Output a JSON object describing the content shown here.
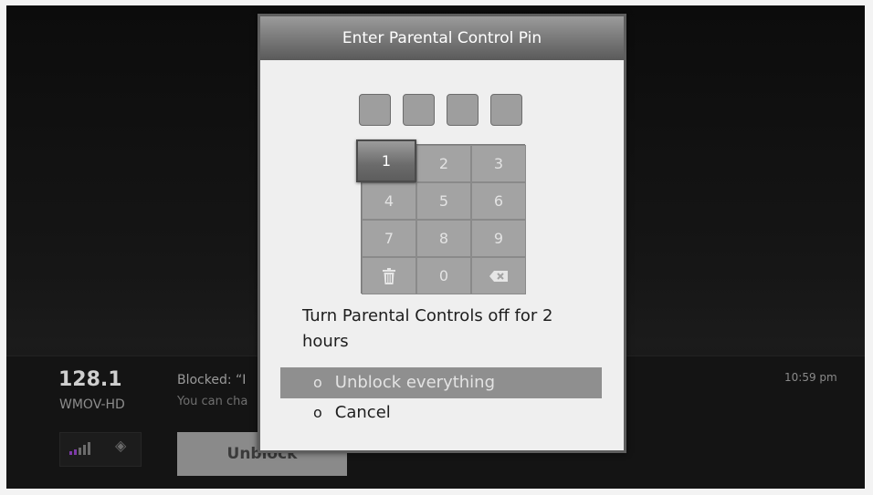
{
  "dialog": {
    "title": "Enter Parental Control Pin",
    "pin_length": 4,
    "keypad": {
      "keys": [
        "1",
        "2",
        "3",
        "4",
        "5",
        "6",
        "7",
        "8",
        "9",
        "trash-icon",
        "0",
        "backspace-icon"
      ],
      "focused": "1"
    },
    "message": "Turn Parental Controls off for 2 hours",
    "options": [
      {
        "label": "Unblock everything",
        "selected": true
      },
      {
        "label": "Cancel",
        "selected": false
      }
    ],
    "bullet": "o"
  },
  "channel": {
    "number": "128.1",
    "name": "WMOV-HD"
  },
  "program": {
    "blocked_text": "Blocked: “I",
    "hint_text": "You can cha"
  },
  "time": "10:59 pm",
  "unblock_button": "Unblock",
  "colors": {
    "dialog_bg": "#efefef",
    "title_bar": "#7d7d7d",
    "signal_bars": "#7d3aa8"
  }
}
